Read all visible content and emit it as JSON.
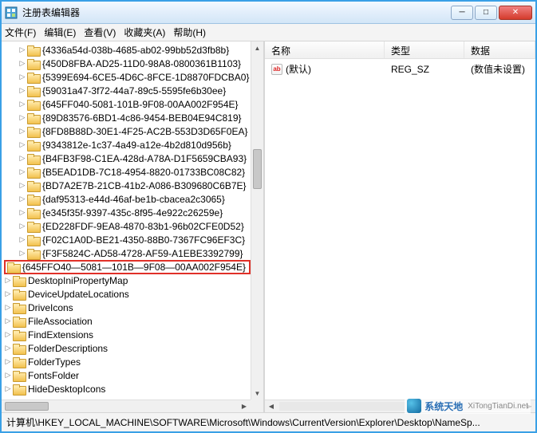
{
  "window": {
    "title": "注册表编辑器"
  },
  "menu": {
    "file": "文件(F)",
    "edit": "编辑(E)",
    "view": "查看(V)",
    "favorites": "收藏夹(A)",
    "help": "帮助(H)"
  },
  "tree": {
    "guid_items": [
      "{4336a54d-038b-4685-ab02-99bb52d3fb8b}",
      "{450D8FBA-AD25-11D0-98A8-0800361B1103}",
      "{5399E694-6CE5-4D6C-8FCE-1D8870FDCBA0}",
      "{59031a47-3f72-44a7-89c5-5595fe6b30ee}",
      "{645FF040-5081-101B-9F08-00AA002F954E}",
      "{89D83576-6BD1-4c86-9454-BEB04E94C819}",
      "{8FD8B88D-30E1-4F25-AC2B-553D3D65F0EA}",
      "{9343812e-1c37-4a49-a12e-4b2d810d956b}",
      "{B4FB3F98-C1EA-428d-A78A-D1F5659CBA93}",
      "{B5EAD1DB-7C18-4954-8820-01733BC08C82}",
      "{BD7A2E7B-21CB-41b2-A086-B309680C6B7E}",
      "{daf95313-e44d-46af-be1b-cbacea2c3065}",
      "{e345f35f-9397-435c-8f95-4e922c26259e}",
      "{ED228FDF-9EA8-4870-83b1-96b02CFE0D52}",
      "{F02C1A0D-BE21-4350-88B0-7367FC96EF3C}",
      "{F3F5824C-AD58-4728-AF59-A1EBE3392799}"
    ],
    "highlighted_item": "{645FFO40—5081—101B—9F08—00AA002F954E}",
    "plain_items": [
      "DesktopIniPropertyMap",
      "DeviceUpdateLocations",
      "DriveIcons",
      "FileAssociation",
      "FindExtensions",
      "FolderDescriptions",
      "FolderTypes",
      "FontsFolder",
      "HideDesktopIcons"
    ]
  },
  "list": {
    "columns": {
      "name": "名称",
      "type": "类型",
      "data": "数据"
    },
    "rows": [
      {
        "name": "(默认)",
        "type": "REG_SZ",
        "data": "(数值未设置)"
      }
    ]
  },
  "statusbar": {
    "path": "计算机\\HKEY_LOCAL_MACHINE\\SOFTWARE\\Microsoft\\Windows\\CurrentVersion\\Explorer\\Desktop\\NameSp..."
  },
  "watermark": {
    "cn": "系统天地",
    "en": "XiTongTianDi.net"
  }
}
